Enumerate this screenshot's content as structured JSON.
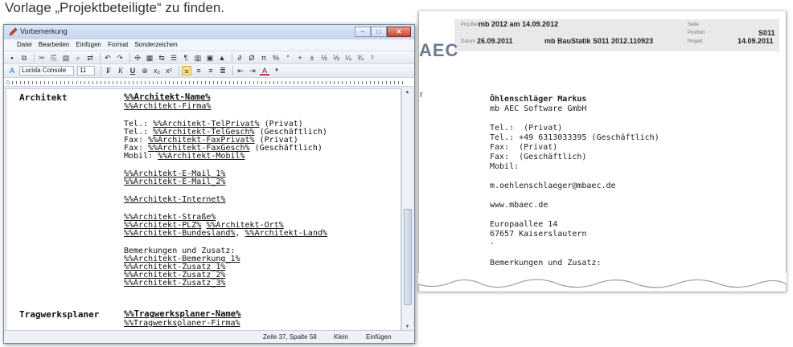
{
  "caption": "Vorlage „Projektbeteiligte“ zu finden.",
  "colors": {
    "window_border": "#7a8ba3",
    "titlebar": "#c4d5ec",
    "close_button": "#c8452f",
    "paper_header": "#e9e9e9"
  },
  "editor": {
    "title": "Vorbemerkung",
    "menu": [
      "Datei",
      "Bearbeiten",
      "Einfügen",
      "Format",
      "Sonderzeichen"
    ],
    "font": {
      "name": "Lucida Console",
      "size": "11"
    },
    "format_buttons": [
      "F",
      "K",
      "U"
    ],
    "status": {
      "position": "Zeile 37, Spalte 58",
      "mode": "Klein",
      "insert": "Einfügen"
    },
    "document": {
      "architekt_label": "Architekt",
      "architekt_name": "%%Architekt-Name%",
      "architekt_firma": "%%Architekt-Firma%",
      "tel_label": "Tel.: ",
      "tel_privat": "%%Architekt-TelPrivat%",
      "privat_suffix": " (Privat)",
      "tel_gesch": "%%Architekt-TelGesch%",
      "gesch_suffix": " (Geschäftlich)",
      "fax_label": "Fax: ",
      "fax_privat": "%%Architekt-FaxPrivat%",
      "fax_gesch": "%%Architekt-FaxGesch%",
      "mobil_label": "Mobil: ",
      "mobil": "%%Architekt-Mobil%",
      "email1": "%%Architekt-E-Mail_1%",
      "email2": "%%Architekt-E-Mail_2%",
      "internet": "%%Architekt-Internet%",
      "strasse": "%%Architekt-Straße%",
      "plz": "%%Architekt-PLZ%",
      "ort": "%%Architekt-Ort%",
      "bundesland": "%%Architekt-Bundesland%",
      "land": "%%Architekt-Land%",
      "comma": ", ",
      "bemerkungen_label": "Bemerkungen und Zusatz:",
      "bemerkung1": "%%Architekt-Bemerkung_1%",
      "zusatz1": "%%Architekt-Zusatz_1%",
      "zusatz2": "%%Architekt-Zusatz_2%",
      "zusatz3": "%%Architekt-Zusatz_3%",
      "tragwerk_label": "Tragwerksplaner",
      "tragwerk_name": "%%Tragwerksplaner-Name%",
      "tragwerk_firma": "%%Tragwerksplaner-Firma%"
    }
  },
  "preview": {
    "logo": "AEC",
    "header": {
      "pos_label": "Proj.Bez.",
      "proj": "mb 2012 am 14.09.2012",
      "seite_label": "Seite",
      "position_label": "Position",
      "position": "S011",
      "datum_label": "Datum",
      "datum": "26.09.2011",
      "software": "mb BauStatik S011  2012.110923",
      "projekt_label": "Projekt",
      "projekt_date": "14.09.2011"
    },
    "left_char": "r",
    "name": "Öhlenschläger Markus",
    "company": "mb AEC Software GmbH",
    "tel1": "Tel.:  (Privat)",
    "tel2": "Tel.: +49 6313033395 (Geschäftlich)",
    "fax1": "Fax:  (Privat)",
    "fax2": "Fax:  (Geschäftlich)",
    "mobil": "Mobil:",
    "email": "m.oehlenschlaeger@mbaec.de",
    "web": "www.mbaec.de",
    "street": "Europaallee 14",
    "city": "67657 Kaiserslautern",
    "dot": "·",
    "remarks": "Bemerkungen und Zusatz:"
  }
}
